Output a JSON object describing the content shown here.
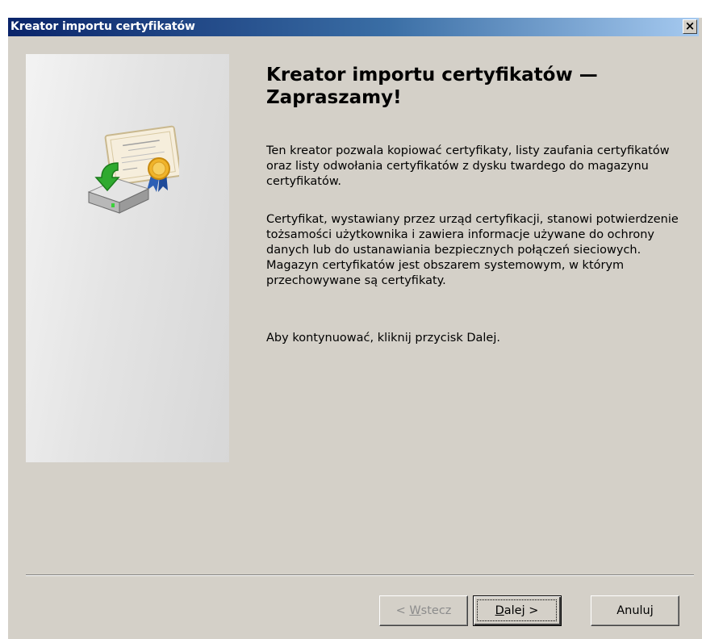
{
  "window": {
    "title": "Kreator importu certyfikatów",
    "close_label": "×"
  },
  "main": {
    "heading": "Kreator importu certyfikatów — Zapraszamy!",
    "paragraph_1": "Ten kreator pozwala kopiować certyfikaty, listy zaufania certyfikatów oraz listy odwołania certyfikatów z dysku twardego do magazynu certyfikatów.",
    "paragraph_2": "Certyfikat, wystawiany przez urząd certyfikacji, stanowi potwierdzenie tożsamości użytkownika i zawiera informacje używane do ochrony danych lub do ustanawiania bezpiecznych połączeń sieciowych. Magazyn certyfikatów jest obszarem systemowym, w którym przechowywane są certyfikaty.",
    "paragraph_3": "Aby kontynuować, kliknij przycisk Dalej."
  },
  "buttons": {
    "back": {
      "prefix": "< ",
      "accel": "W",
      "rest": "stecz",
      "enabled": false
    },
    "next": {
      "accel": "D",
      "rest": "alej >",
      "enabled": true
    },
    "cancel": {
      "label": "Anuluj",
      "enabled": true
    }
  },
  "icons": {
    "wizard": "certificate-import-icon"
  },
  "colors": {
    "titlebar_start": "#0a246a",
    "titlebar_end": "#a6caf0",
    "dialog_bg": "#d4d0c8",
    "disabled_text": "#8c8c8c"
  }
}
